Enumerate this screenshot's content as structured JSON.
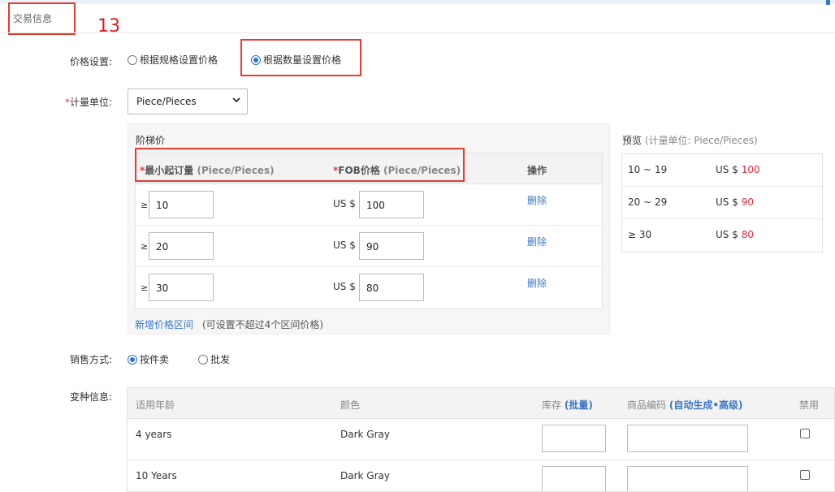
{
  "section_title": "交易信息",
  "annotation_number": "13",
  "price_setting": {
    "label": "价格设置:",
    "options": [
      "根据规格设置价格",
      "根据数量设置价格"
    ],
    "selected_index": 1
  },
  "unit": {
    "label": "计量单位:",
    "required_mark": "*",
    "value": "Piece/Pieces"
  },
  "tier_price": {
    "title": "阶梯价",
    "header": {
      "required_mark": "*",
      "min_qty": "最小起订量",
      "min_qty_unit": "(Piece/Pieces)",
      "fob": "FOB价格",
      "fob_unit": "(Piece/Pieces)",
      "action": "操作"
    },
    "rows": [
      {
        "ge": "≥",
        "qty": "10",
        "currency": "US $",
        "price": "100",
        "delete": "删除"
      },
      {
        "ge": "≥",
        "qty": "20",
        "currency": "US $",
        "price": "90",
        "delete": "删除"
      },
      {
        "ge": "≥",
        "qty": "30",
        "currency": "US $",
        "price": "80",
        "delete": "删除"
      }
    ],
    "add_link": "新增价格区间",
    "add_note": "(可设置不超过4个区间价格)"
  },
  "preview": {
    "title": "预览",
    "unit_note": "(计量单位:  Piece/Pieces)",
    "rows": [
      {
        "range": "10 ~ 19",
        "currency": "US $",
        "price": "100"
      },
      {
        "range": "20 ~ 29",
        "currency": "US $",
        "price": "90"
      },
      {
        "range": "≥ 30",
        "currency": "US $",
        "price": "80"
      }
    ]
  },
  "sales_method": {
    "label": "销售方式:",
    "options": [
      "按件卖",
      "批发"
    ],
    "selected_index": 0
  },
  "variants": {
    "label": "变种信息:",
    "columns": {
      "age": "适用年龄",
      "color": "颜色",
      "stock": "库存",
      "stock_link": "(批量)",
      "sku": "商品编码",
      "sku_link": "(自动生成•高级)",
      "disable": "禁用"
    },
    "rows": [
      {
        "age": "4 years",
        "color": "Dark Gray"
      },
      {
        "age": "10 Years",
        "color": "Dark Gray"
      }
    ]
  },
  "colors": {
    "accent": "#3a76c4",
    "annotation": "#e53b2f",
    "price_red": "#e4293c"
  }
}
